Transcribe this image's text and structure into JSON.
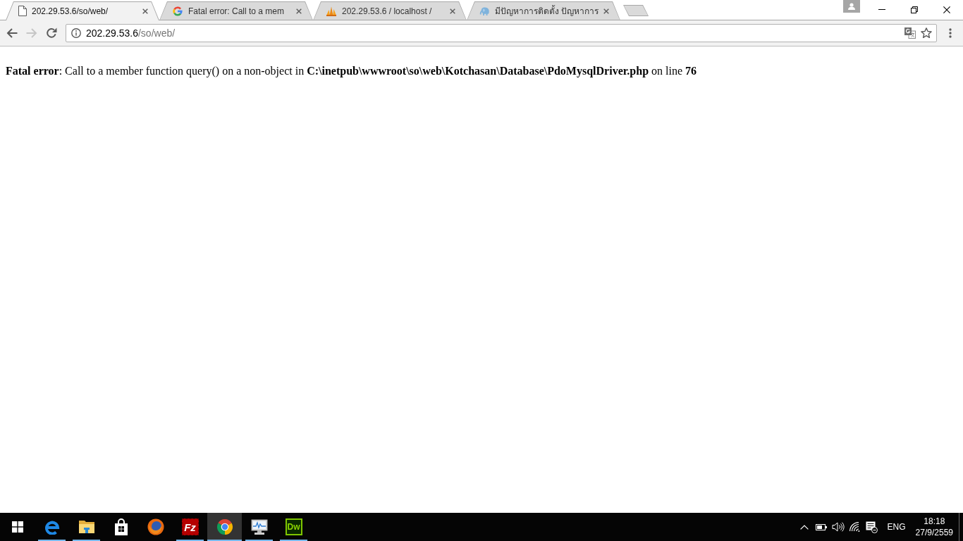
{
  "tabs": [
    {
      "kind": "page",
      "title": "202.29.53.6/so/web/",
      "selected": true
    },
    {
      "kind": "google",
      "title": "Fatal error: Call to a mem",
      "selected": false
    },
    {
      "kind": "pma",
      "title": "202.29.53.6 / localhost /",
      "selected": false
    },
    {
      "kind": "elephant",
      "title": "มีปัญหาการติดตั้ง ปัญหาการ",
      "selected": false
    }
  ],
  "toolbar": {
    "nav_buttons": [
      {
        "kind": "back",
        "disabled": false
      },
      {
        "kind": "forward",
        "disabled": true
      },
      {
        "kind": "reload",
        "disabled": false
      }
    ],
    "address_bar": {
      "host": "202.29.53.6",
      "path": "/so/web/"
    },
    "bookmarked": false
  },
  "page": {
    "error_message": "**Fatal error**: Call to a member function query() on a non-object in **C:\\inetpub\\wwwroot\\so\\web\\Kotchasan\\Database\\PdoMysqlDriver.php** on line **76**"
  },
  "taskbar": {
    "apps": [
      {
        "kind": "edge",
        "running": true,
        "selected": false
      },
      {
        "kind": "explorer",
        "running": true,
        "selected": false
      },
      {
        "kind": "store",
        "running": false,
        "selected": false
      },
      {
        "kind": "firefox",
        "running": false,
        "selected": false
      },
      {
        "kind": "filezilla",
        "label": "Fz",
        "running": true,
        "selected": false
      },
      {
        "kind": "chrome",
        "running": true,
        "selected": true
      },
      {
        "kind": "monitor",
        "running": true,
        "selected": false
      },
      {
        "kind": "dreamweaver",
        "label": "Dw",
        "running": true,
        "selected": false
      }
    ],
    "tray": {
      "language": "ENG",
      "time": "18:18",
      "date": "27/9/2559"
    }
  }
}
